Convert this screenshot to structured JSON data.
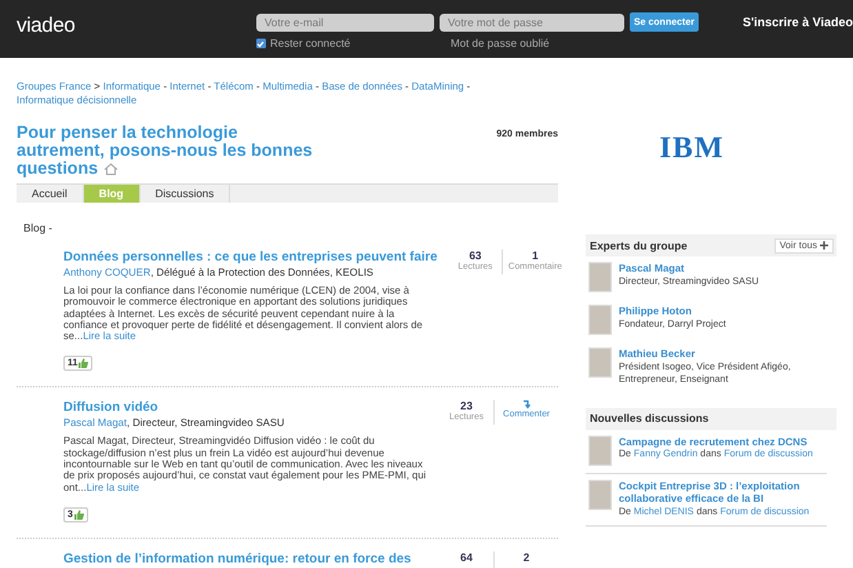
{
  "header": {
    "logo": "viadeo",
    "email": {
      "placeholder": "Votre e-mail"
    },
    "password": {
      "placeholder": "Votre mot de passe"
    },
    "login_button": "Se connecter",
    "register_link": "S'inscrire à Viadeo",
    "remember": {
      "label": "Rester connecté",
      "checked": true
    },
    "forgot_link": "Mot de passe oublié"
  },
  "breadcrumb": {
    "root": "Groupes France",
    "separator": ">",
    "category_separator": "-",
    "categories": [
      "Informatique",
      "Internet",
      "Télécom",
      "Multimedia",
      "Base de données",
      "DataMining",
      "Informatique décisionnelle"
    ]
  },
  "group": {
    "title": "Pour penser la technologie autrement, posons-nous les bonnes questions",
    "members": "920 membres",
    "sponsor_logo": "IBM"
  },
  "tabs": [
    {
      "label": "Accueil",
      "selected": false
    },
    {
      "label": "Blog",
      "selected": true
    },
    {
      "label": "Discussions",
      "selected": false
    }
  ],
  "section_label": "Blog -",
  "posts": [
    {
      "title": "Données personnelles : ce que les entreprises peuvent faire",
      "author": "Anthony COQUER",
      "role": ", Délégué à la Protection des Données, KEOLIS",
      "excerpt": "La loi pour la confiance dans l’économie numérique (LCEN) de 2004, vise à promouvoir le commerce électronique en apportant des solutions juridiques adaptées à Internet. Les excès de sécurité peuvent cependant nuire à la confiance et provoquer perte de fidélité et désengagement. Il convient alors de se...",
      "read_more": "Lire la suite",
      "likes": "11",
      "reads": "63",
      "reads_label": "Lectures",
      "comments": {
        "kind": "count",
        "count": "1",
        "label": "Commentaire"
      }
    },
    {
      "title": "Diffusion vidéo",
      "author": "Pascal Magat",
      "role": ", Directeur, Streamingvideo SASU",
      "excerpt": "Pascal Magat, Directeur, Streamingvidéo Diffusion vidéo : le coût du stockage/diffusion n’est plus un frein La vidéo est aujourd’hui devenue incontournable sur le Web en tant qu’outil de communication. Avec les niveaux de prix proposés aujourd’hui, ce constat vaut également pour les PME-PMI, qui ont...",
      "read_more": "Lire la suite",
      "likes": "3",
      "reads": "23",
      "reads_label": "Lectures",
      "comments": {
        "kind": "action",
        "label": "Commenter"
      }
    },
    {
      "title": "Gestion de l’information numérique: retour en force des",
      "reads": "64",
      "comments": {
        "kind": "count",
        "count": "2"
      }
    }
  ],
  "experts": {
    "title": "Experts du groupe",
    "see_all": "Voir tous",
    "items": [
      {
        "name": "Pascal Magat",
        "role": "Directeur, Streamingvideo SASU"
      },
      {
        "name": "Philippe Hoton",
        "role": "Fondateur, Darryl Project"
      },
      {
        "name": "Mathieu Becker",
        "role": "Président Isogeo, Vice Président Afigéo, Entrepreneur, Enseignant"
      }
    ]
  },
  "discussions": {
    "title": "Nouvelles discussions",
    "items": [
      {
        "title": "Campagne de recrutement chez DCNS",
        "by": "De",
        "author": "Fanny Gendrin",
        "in": "dans",
        "forum": "Forum de discussion"
      },
      {
        "title": "Cockpit Entreprise 3D : l’exploitation collaborative efficace de la BI",
        "by": "De",
        "author": "Michel DENIS",
        "in": "dans",
        "forum": "Forum de discussion"
      }
    ]
  }
}
